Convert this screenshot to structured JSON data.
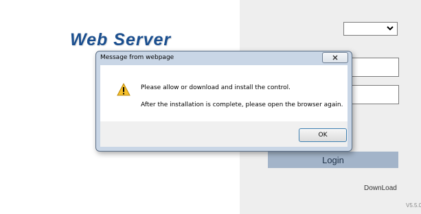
{
  "app": {
    "logo_text": "Web Server",
    "version": "V5.5.0"
  },
  "login_panel": {
    "language_select": {
      "selected": ""
    },
    "username": {
      "value": ""
    },
    "password": {
      "value": ""
    },
    "login_label": "Login",
    "download_label": "DownLoad"
  },
  "dialog": {
    "title": "Message from webpage",
    "close_icon": "close-icon",
    "icon": "warning-icon",
    "message_line1": "Please allow or download and install the control.",
    "message_line2": "After the installation is complete, please open the browser again.",
    "ok_label": "OK"
  },
  "colors": {
    "logo": "#1b4f8f",
    "login_button": "#a3b4c9",
    "right_panel": "#eeeeee",
    "dialog_frame": "#c9d6e6"
  }
}
